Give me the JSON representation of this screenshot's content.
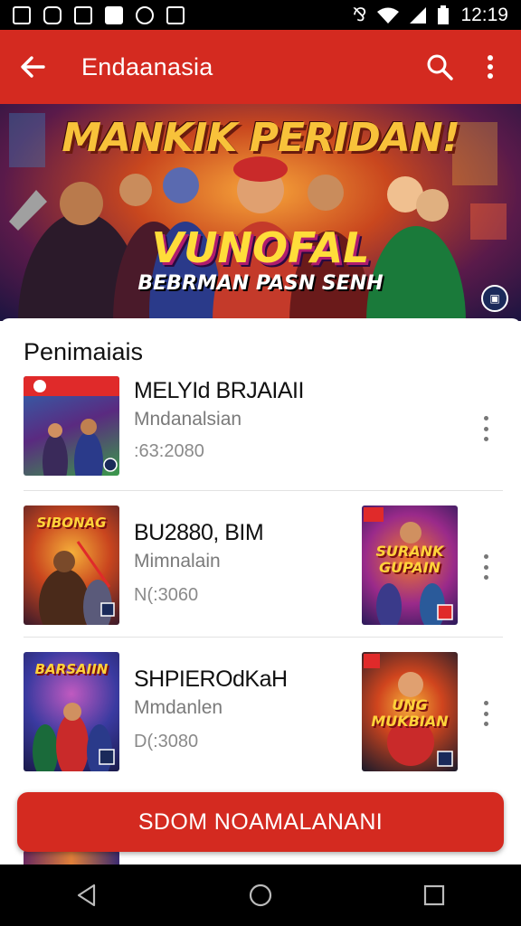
{
  "status_bar": {
    "time": "12:19",
    "icons": [
      "image-icon",
      "whatsapp-icon",
      "photo-icon",
      "bookmark-icon",
      "chrome-icon",
      "camera-icon"
    ],
    "right_icons": [
      "vibrate-icon",
      "wifi-icon",
      "signal-icon",
      "battery-icon"
    ]
  },
  "app_bar": {
    "title": "Endaanasia",
    "back_icon": "arrow-left-icon",
    "search_icon": "search-icon",
    "more_icon": "more-vert-icon",
    "color": "#d42a20"
  },
  "hero": {
    "title": "MANKIK PERIDAN!",
    "headline": "VUNOFAL",
    "subtitle": "BEBRMAN PASN SENH"
  },
  "section": {
    "title": "Penimaiais"
  },
  "items": [
    {
      "name": "MELYId BRJAIAII",
      "subtitle": "Mndanalsian",
      "meta": ":63:2080"
    },
    {
      "name": "BU2880, BIM",
      "subtitle": "Mimnalain",
      "meta": "N(:3060",
      "side_art": "SURANK GUPAIN"
    },
    {
      "name": "SHPIEROdKaH",
      "subtitle": "Mmdanlen",
      "meta": "D(:3080",
      "side_art": "UNG MUKBIAN"
    }
  ],
  "art_labels": {
    "thumb_1": "",
    "thumb_2": "SIBONAG",
    "thumb_3": "BARSAIIN"
  },
  "cta": {
    "label": "SDOM NOAMALANANI"
  },
  "nav_bar": {
    "icons": [
      "nav-back-icon",
      "nav-home-icon",
      "nav-recents-icon"
    ]
  }
}
